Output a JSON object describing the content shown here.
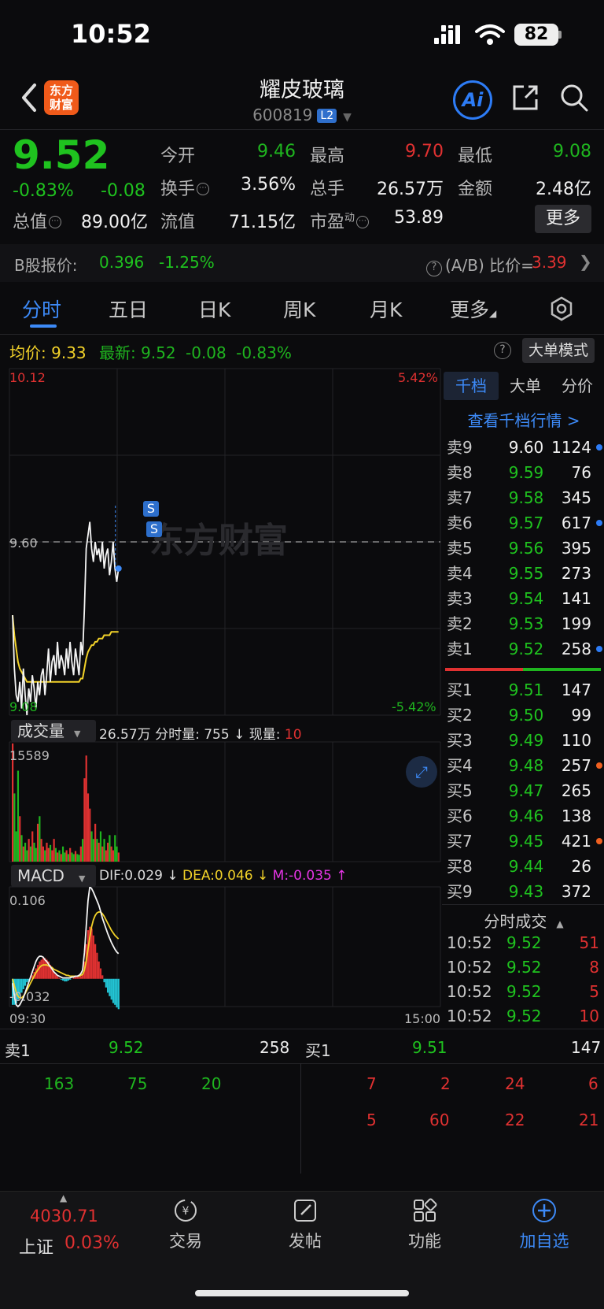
{
  "status": {
    "time": "10:52",
    "battery": "82"
  },
  "header": {
    "logo_text": "东方财富",
    "stock_name": "耀皮玻璃",
    "stock_code": "600819",
    "level_badge": "L2",
    "ai_label": "Ai"
  },
  "quote": {
    "price": "9.52",
    "pct": "-0.83%",
    "chg": "-0.08",
    "labels": {
      "open": "今开",
      "high": "最高",
      "low": "最低",
      "turnover": "换手",
      "volume": "总手",
      "amount": "金额",
      "mktcap": "总值",
      "float": "流值",
      "pe": "市盈",
      "pe_sup": "动"
    },
    "open": "9.46",
    "high": "9.70",
    "low": "9.08",
    "turnover": "3.56%",
    "volume": "26.57万",
    "amount": "2.48亿",
    "mktcap": "89.00亿",
    "float": "71.15亿",
    "pe": "53.89",
    "more_label": "更多"
  },
  "b_share": {
    "label": "B股报价:",
    "price": "0.396",
    "pct": "-1.25%",
    "ab_label": "(A/B) 比价=",
    "ab_value": "3.39"
  },
  "tabs": [
    "分时",
    "五日",
    "日K",
    "周K",
    "月K",
    "更多"
  ],
  "avg_row": {
    "avg_label": "均价:",
    "avg_value": "9.33",
    "latest_label": "最新:",
    "latest_value": "9.52",
    "chg": "-0.08",
    "pct": "-0.83%"
  },
  "big_order_mode": "大单模式",
  "chart_labels": {
    "price_max": "10.12",
    "price_min": "9.08",
    "ref_price": "9.60",
    "pct_max": "5.42%",
    "pct_min": "-5.42%",
    "watermark": "东方财富",
    "volume_selector": "成交量",
    "volume_total": "26.57万",
    "minute_vol_label": "分时量:",
    "minute_vol": "755",
    "now_vol_label": "现量:",
    "now_vol": "10",
    "vol_max": "15589",
    "macd_selector": "MACD",
    "dif": "DIF:0.029",
    "dea": "DEA:0.046",
    "m": "M:-0.035",
    "macd_max": "0.106",
    "macd_min": "-0.032",
    "time_start": "09:30",
    "time_end": "15:00",
    "marker": "S"
  },
  "chart_data": {
    "type": "line",
    "price_series": [
      9.38,
      9.22,
      9.14,
      9.12,
      9.18,
      9.1,
      9.22,
      9.14,
      9.08,
      9.16,
      9.12,
      9.2,
      9.16,
      9.1,
      9.18,
      9.14,
      9.2,
      9.22,
      9.14,
      9.2,
      9.28,
      9.18,
      9.24,
      9.26,
      9.2,
      9.3,
      9.22,
      9.26,
      9.24,
      9.2,
      9.28,
      9.22,
      9.3,
      9.24,
      9.2,
      9.28,
      9.24,
      9.2,
      9.3,
      9.26,
      9.4,
      9.58,
      9.62,
      9.66,
      9.58,
      9.54,
      9.6,
      9.56,
      9.58,
      9.54,
      9.6,
      9.52,
      9.56,
      9.58,
      9.5,
      9.54,
      9.6,
      9.52,
      9.48,
      9.52
    ],
    "avg_series": [
      9.38,
      9.32,
      9.28,
      9.24,
      9.22,
      9.21,
      9.2,
      9.19,
      9.18,
      9.18,
      9.18,
      9.18,
      9.18,
      9.18,
      9.18,
      9.18,
      9.18,
      9.18,
      9.18,
      9.18,
      9.18,
      9.18,
      9.18,
      9.18,
      9.18,
      9.18,
      9.18,
      9.18,
      9.18,
      9.18,
      9.18,
      9.18,
      9.18,
      9.18,
      9.18,
      9.18,
      9.18,
      9.18,
      9.19,
      9.19,
      9.22,
      9.25,
      9.27,
      9.28,
      9.29,
      9.29,
      9.3,
      9.3,
      9.31,
      9.31,
      9.31,
      9.32,
      9.32,
      9.32,
      9.32,
      9.33,
      9.33,
      9.33,
      9.33,
      9.33
    ],
    "price_range": [
      9.08,
      10.12
    ],
    "ref_price": 9.6,
    "volume_series": [
      15589,
      9000,
      4000,
      12000,
      6000,
      3500,
      2000,
      2500,
      1500,
      3000,
      2000,
      4000,
      2500,
      1800,
      5000,
      6000,
      3000,
      2000,
      1500,
      2500,
      1800,
      2200,
      1500,
      3000,
      1800,
      1200,
      1500,
      1000,
      2000,
      1200,
      1500,
      1000,
      1800,
      1200,
      1000,
      1400,
      1000,
      900,
      2000,
      3000,
      11000,
      14000,
      9000,
      7000,
      4000,
      3000,
      5000,
      3000,
      2500,
      4000,
      2000,
      3000,
      1500,
      2500,
      3500,
      2000,
      1500,
      3500,
      2000,
      1200
    ],
    "volume_max": 15589,
    "macd_hist": [
      -0.03,
      -0.03,
      -0.028,
      -0.024,
      -0.02,
      -0.016,
      -0.012,
      -0.008,
      -0.004,
      -0.002,
      0,
      0.004,
      0.008,
      0.012,
      0.016,
      0.02,
      0.022,
      0.024,
      0.024,
      0.022,
      0.02,
      0.016,
      0.012,
      0.008,
      0.005,
      0.003,
      0.001,
      -0.001,
      -0.002,
      -0.003,
      -0.003,
      -0.002,
      -0.001,
      0,
      0.001,
      0.002,
      0.002,
      0.002,
      0.003,
      0.005,
      0.02,
      0.04,
      0.056,
      0.06,
      0.058,
      0.05,
      0.04,
      0.03,
      0.02,
      0.012,
      0.004,
      -0.004,
      -0.01,
      -0.016,
      -0.02,
      -0.024,
      -0.028,
      -0.03,
      -0.033,
      -0.035
    ],
    "dif_series": [
      -0.005,
      -0.02,
      -0.03,
      -0.032,
      -0.03,
      -0.026,
      -0.022,
      -0.016,
      -0.01,
      -0.004,
      0.002,
      0.008,
      0.014,
      0.02,
      0.024,
      0.026,
      0.026,
      0.025,
      0.022,
      0.02,
      0.017,
      0.014,
      0.011,
      0.008,
      0.006,
      0.004,
      0.003,
      0.002,
      0.001,
      0.001,
      0.001,
      0.001,
      0.001,
      0.002,
      0.002,
      0.003,
      0.003,
      0.004,
      0.006,
      0.01,
      0.03,
      0.06,
      0.09,
      0.106,
      0.104,
      0.1,
      0.095,
      0.09,
      0.085,
      0.078,
      0.07,
      0.064,
      0.058,
      0.052,
      0.047,
      0.042,
      0.038,
      0.034,
      0.031,
      0.029
    ],
    "dea_series": [
      0,
      -0.008,
      -0.015,
      -0.02,
      -0.022,
      -0.022,
      -0.02,
      -0.017,
      -0.013,
      -0.009,
      -0.005,
      -0.001,
      0.003,
      0.007,
      0.01,
      0.013,
      0.015,
      0.016,
      0.016,
      0.016,
      0.015,
      0.014,
      0.013,
      0.011,
      0.01,
      0.009,
      0.008,
      0.007,
      0.006,
      0.005,
      0.004,
      0.004,
      0.003,
      0.003,
      0.003,
      0.003,
      0.003,
      0.003,
      0.004,
      0.005,
      0.01,
      0.02,
      0.034,
      0.048,
      0.06,
      0.068,
      0.073,
      0.076,
      0.077,
      0.077,
      0.075,
      0.072,
      0.068,
      0.064,
      0.06,
      0.056,
      0.053,
      0.05,
      0.048,
      0.046
    ],
    "macd_range": [
      -0.032,
      0.106
    ],
    "minutes_total": 240
  },
  "order_book": {
    "tabs": [
      "千档",
      "大单",
      "分价"
    ],
    "depth_link": "查看千档行情 >",
    "asks": [
      {
        "label": "卖9",
        "price": "9.60",
        "vol": "1124",
        "dot": "#2d7cf6",
        "price_color": "#f0f0f0"
      },
      {
        "label": "卖8",
        "price": "9.59",
        "vol": "76",
        "dot": "",
        "price_color": "#1fc21f"
      },
      {
        "label": "卖7",
        "price": "9.58",
        "vol": "345",
        "dot": "",
        "price_color": "#1fc21f"
      },
      {
        "label": "卖6",
        "price": "9.57",
        "vol": "617",
        "dot": "#2d7cf6",
        "price_color": "#1fc21f"
      },
      {
        "label": "卖5",
        "price": "9.56",
        "vol": "395",
        "dot": "",
        "price_color": "#1fc21f"
      },
      {
        "label": "卖4",
        "price": "9.55",
        "vol": "273",
        "dot": "",
        "price_color": "#1fc21f"
      },
      {
        "label": "卖3",
        "price": "9.54",
        "vol": "141",
        "dot": "",
        "price_color": "#1fc21f"
      },
      {
        "label": "卖2",
        "price": "9.53",
        "vol": "199",
        "dot": "",
        "price_color": "#1fc21f"
      },
      {
        "label": "卖1",
        "price": "9.52",
        "vol": "258",
        "dot": "#2d7cf6",
        "price_color": "#1fc21f"
      }
    ],
    "bids": [
      {
        "label": "买1",
        "price": "9.51",
        "vol": "147",
        "dot": ""
      },
      {
        "label": "买2",
        "price": "9.50",
        "vol": "99",
        "dot": ""
      },
      {
        "label": "买3",
        "price": "9.49",
        "vol": "110",
        "dot": ""
      },
      {
        "label": "买4",
        "price": "9.48",
        "vol": "257",
        "dot": "#f06020"
      },
      {
        "label": "买5",
        "price": "9.47",
        "vol": "265",
        "dot": ""
      },
      {
        "label": "买6",
        "price": "9.46",
        "vol": "138",
        "dot": ""
      },
      {
        "label": "买7",
        "price": "9.45",
        "vol": "421",
        "dot": "#f06020"
      },
      {
        "label": "买8",
        "price": "9.44",
        "vol": "26",
        "dot": ""
      },
      {
        "label": "买9",
        "price": "9.43",
        "vol": "372",
        "dot": ""
      }
    ],
    "trades_title": "分时成交",
    "trades": [
      {
        "time": "10:52",
        "price": "9.52",
        "vol": "51"
      },
      {
        "time": "10:52",
        "price": "9.52",
        "vol": "8"
      },
      {
        "time": "10:52",
        "price": "9.52",
        "vol": "5"
      },
      {
        "time": "10:52",
        "price": "9.52",
        "vol": "10"
      }
    ]
  },
  "bottom_quote": {
    "sell_label": "卖1",
    "sell_price": "9.52",
    "sell_vol": "258",
    "buy_label": "买1",
    "buy_price": "9.51",
    "buy_vol": "147",
    "sell_queue": [
      "163",
      "75",
      "20"
    ],
    "buy_queue_1": [
      "7",
      "2",
      "24",
      "6"
    ],
    "buy_queue_2": [
      "5",
      "60",
      "22",
      "21"
    ]
  },
  "tabbar": {
    "index_value": "4030.71",
    "index_name": "上证",
    "index_pct": "0.03%",
    "items": [
      "交易",
      "发帖",
      "功能",
      "加自选"
    ]
  }
}
